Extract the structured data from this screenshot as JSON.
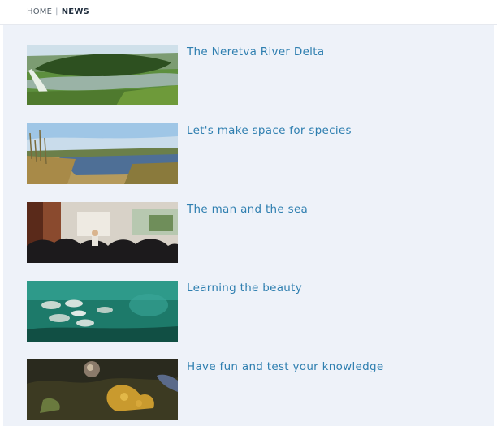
{
  "breadcrumb": {
    "home": "HOME",
    "separator": "|",
    "current": "NEWS"
  },
  "news": [
    {
      "title": "The Neretva River Delta",
      "image": "river-delta-photo"
    },
    {
      "title": "Let's make space for species",
      "image": "wetland-reeds-photo"
    },
    {
      "title": "The man and the sea",
      "image": "lecture-audience-photo"
    },
    {
      "title": "Learning the beauty",
      "image": "underwater-fish-photo"
    },
    {
      "title": "Have fun and test your knowledge",
      "image": "coral-reef-photo"
    }
  ],
  "colors": {
    "link": "#2f7fb0",
    "background": "#eef2f9"
  }
}
